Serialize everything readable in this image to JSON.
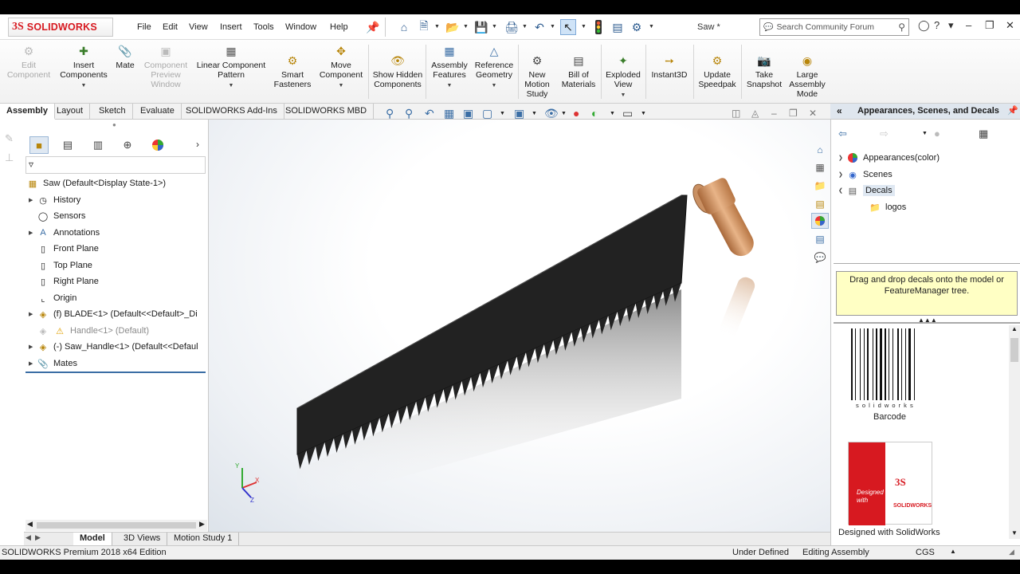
{
  "app": {
    "brand": "SOLIDWORKS",
    "brand_mark": "3S",
    "document_title": "Saw *"
  },
  "menu": [
    "File",
    "Edit",
    "View",
    "Insert",
    "Tools",
    "Window",
    "Help"
  ],
  "search": {
    "placeholder": "Search Community Forum"
  },
  "commands": [
    {
      "label": "Edit Component",
      "disabled": true
    },
    {
      "label": "Insert Components",
      "disabled": false
    },
    {
      "label": "Mate",
      "disabled": false
    },
    {
      "label": "Component Preview Window",
      "disabled": true
    },
    {
      "label": "Linear Component Pattern",
      "disabled": false
    },
    {
      "label": "Smart Fasteners",
      "disabled": false
    },
    {
      "label": "Move Component",
      "disabled": false
    },
    {
      "label": "Show Hidden Components",
      "disabled": false
    },
    {
      "label": "Assembly Features",
      "disabled": false
    },
    {
      "label": "Reference Geometry",
      "disabled": false
    },
    {
      "label": "New Motion Study",
      "disabled": false
    },
    {
      "label": "Bill of Materials",
      "disabled": false
    },
    {
      "label": "Exploded View",
      "disabled": false
    },
    {
      "label": "Instant3D",
      "disabled": false
    },
    {
      "label": "Update Speedpak",
      "disabled": false
    },
    {
      "label": "Take Snapshot",
      "disabled": false
    },
    {
      "label": "Large Assembly Mode",
      "disabled": false
    }
  ],
  "command_tabs": [
    "Assembly",
    "Layout",
    "Sketch",
    "Evaluate",
    "SOLIDWORKS Add-Ins",
    "SOLIDWORKS MBD"
  ],
  "tree": {
    "root": "Saw  (Default<Display State-1>)",
    "items": [
      {
        "label": "History",
        "expandable": true
      },
      {
        "label": "Sensors",
        "expandable": false
      },
      {
        "label": "Annotations",
        "expandable": true
      },
      {
        "label": "Front Plane",
        "expandable": false
      },
      {
        "label": "Top Plane",
        "expandable": false
      },
      {
        "label": "Right Plane",
        "expandable": false
      },
      {
        "label": "Origin",
        "expandable": false
      },
      {
        "label": "(f) BLADE<1> (Default<<Default>_Di",
        "expandable": true
      },
      {
        "label": "Handle<1> (Default)",
        "expandable": false
      },
      {
        "label": "(-) Saw_Handle<1> (Default<<Defaul",
        "expandable": true
      },
      {
        "label": "Mates",
        "expandable": true
      }
    ]
  },
  "bottom_tabs": [
    "Model",
    "3D Views",
    "Motion Study 1"
  ],
  "status": {
    "edition": "SOLIDWORKS Premium 2018 x64 Edition",
    "state": "Under Defined",
    "mode": "Editing Assembly",
    "units": "CGS"
  },
  "task_pane": {
    "title": "Appearances, Scenes, and Decals",
    "tree": [
      {
        "label": "Appearances(color)"
      },
      {
        "label": "Scenes"
      },
      {
        "label": "Decals"
      },
      {
        "label": "logos"
      }
    ],
    "tip": "Drag and drop decals onto the model or FeatureManager tree.",
    "decals": [
      {
        "label": "Barcode",
        "code_text": "s o l i d w o r k s"
      },
      {
        "label": "Designed with SolidWorks",
        "art_text_1": "Designed with",
        "art_text_2": "SOLIDWORKS"
      }
    ]
  },
  "triad": {
    "x": "X",
    "y": "Y",
    "z": "Z"
  },
  "colors": {
    "brand_red": "#d71920",
    "accent_blue": "#3b6ea5",
    "tip_yellow": "#ffffc4"
  }
}
